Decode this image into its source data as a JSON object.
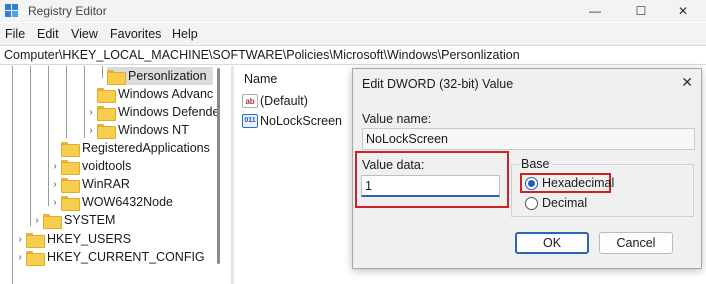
{
  "window": {
    "title": "Registry Editor",
    "controls": {
      "minimize": "—",
      "maximize": "☐",
      "close": "✕"
    }
  },
  "menu": [
    "File",
    "Edit",
    "View",
    "Favorites",
    "Help"
  ],
  "address": "Computer\\HKEY_LOCAL_MACHINE\\SOFTWARE\\Policies\\Microsoft\\Windows\\Personlization",
  "tree": {
    "items": [
      {
        "label": "Personlization",
        "expander": "",
        "selected": true
      },
      {
        "label": "Windows Advanc",
        "expander": ""
      },
      {
        "label": "Windows Defende",
        "expander": "›"
      },
      {
        "label": "Windows NT",
        "expander": "›"
      },
      {
        "label": "RegisteredApplications",
        "expander": ""
      },
      {
        "label": "voidtools",
        "expander": "›"
      },
      {
        "label": "WinRAR",
        "expander": "›"
      },
      {
        "label": "WOW6432Node",
        "expander": "›"
      },
      {
        "label": "SYSTEM",
        "expander": "›"
      },
      {
        "label": "HKEY_USERS",
        "expander": "›"
      },
      {
        "label": "HKEY_CURRENT_CONFIG",
        "expander": "›"
      }
    ]
  },
  "values_pane": {
    "column_header": "Name",
    "rows": [
      {
        "name": "(Default)",
        "icon": "string-value-icon",
        "icon_text": "ab"
      },
      {
        "name": "NoLockScreen",
        "icon": "dword-value-icon",
        "icon_text": "011"
      }
    ]
  },
  "dialog": {
    "title": "Edit DWORD (32-bit) Value",
    "close": "✕",
    "value_name_label": "Value name:",
    "value_name": "NoLockScreen",
    "value_data_label": "Value data:",
    "value_data": "1",
    "base_label": "Base",
    "base_options": [
      {
        "label": "Hexadecimal",
        "checked": true
      },
      {
        "label": "Decimal",
        "checked": false
      }
    ],
    "ok_label": "OK",
    "cancel_label": "Cancel"
  },
  "colors": {
    "highlight_box": "#d0202a",
    "accent": "#2a66b8",
    "folder": "#f7cd4d"
  }
}
